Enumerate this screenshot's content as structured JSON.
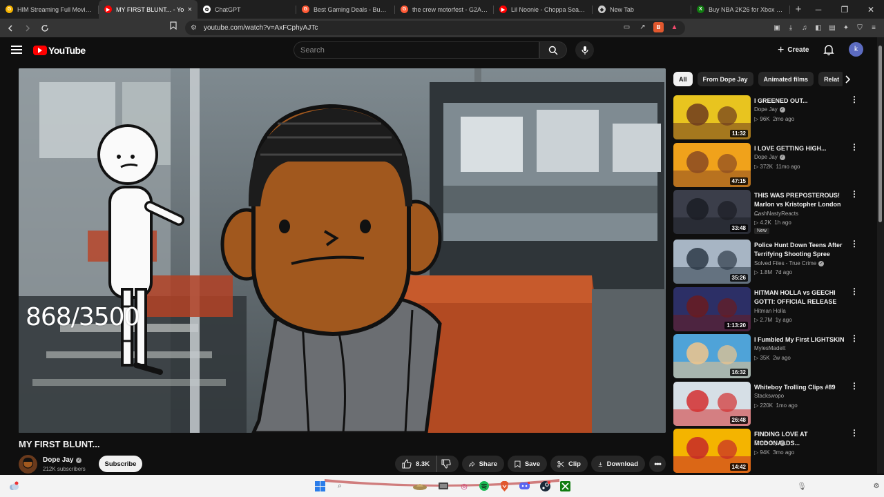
{
  "browser": {
    "tabs": [
      {
        "label": "HIM Streaming Full Movies On",
        "color": "#f6b400",
        "active": false,
        "glyph": "G"
      },
      {
        "label": "MY FIRST BLUNT... - Yo",
        "color": "#ff0000",
        "active": true,
        "glyph": "▶"
      },
      {
        "label": "ChatGPT",
        "color": "#ffffff",
        "active": false,
        "glyph": "✿"
      },
      {
        "label": "Best Gaming Deals - Buy Cheap",
        "color": "#ff5a36",
        "active": false,
        "glyph": "G"
      },
      {
        "label": "the crew motorfest - G2A.COM",
        "color": "#ff5a36",
        "active": false,
        "glyph": "G"
      },
      {
        "label": "Lil Noonie - Choppa Season |",
        "color": "#ff0000",
        "active": false,
        "glyph": "▶"
      },
      {
        "label": "New Tab",
        "color": "#cccccc",
        "active": false,
        "glyph": "◆"
      },
      {
        "label": "Buy NBA 2K26 for Xbox One |",
        "color": "#107c10",
        "active": false,
        "glyph": "X"
      }
    ],
    "url": "youtube.com/watch?v=AxFCphyAJTc"
  },
  "masthead": {
    "logo_text": "YouTube",
    "search_placeholder": "Search",
    "create_label": "Create",
    "avatar_letter": "k"
  },
  "player": {
    "overlay_counter": "868/3500"
  },
  "video": {
    "title": "MY FIRST BLUNT...",
    "channel": "Dope Jay",
    "subscribers": "212K subscribers",
    "subscribe_label": "Subscribe",
    "likes": "8.3K",
    "share_label": "Share",
    "save_label": "Save",
    "clip_label": "Clip",
    "download_label": "Download"
  },
  "chips": [
    "All",
    "From Dope Jay",
    "Animated films",
    "Relat"
  ],
  "recommendations": [
    {
      "title": "I GREENED OUT...",
      "channel": "Dope Jay",
      "verified": true,
      "views": "96K",
      "age": "2mo ago",
      "duration": "11:32",
      "bg": "#e8c41f",
      "accent": "#6d3b1e",
      "new": false
    },
    {
      "title": "I LOVE GETTING HIGH...",
      "channel": "Dope Jay",
      "verified": true,
      "views": "372K",
      "age": "11mo ago",
      "duration": "47:15",
      "bg": "#f0a21b",
      "accent": "#8a4a22",
      "new": false
    },
    {
      "title": "THIS WAS PREPOSTEROUS! Marlon vs Kristopher London ...",
      "channel": "CashNastyReacts",
      "verified": false,
      "views": "4.2K",
      "age": "1h ago",
      "duration": "33:48",
      "bg": "#3b3e4a",
      "accent": "#1b1d24",
      "new": true,
      "new_label": "New"
    },
    {
      "title": "Police Hunt Down Teens After Terrifying Shooting Spree",
      "channel": "Solved Files - True Crime",
      "verified": true,
      "views": "1.8M",
      "age": "7d ago",
      "duration": "35:26",
      "bg": "#a7b5c4",
      "accent": "#2d3a48",
      "new": false
    },
    {
      "title": "HITMAN HOLLA vs GEECHI GOTTI: OFFICIAL RELEASE",
      "channel": "Hitman Holla",
      "verified": false,
      "views": "2.7M",
      "age": "1y ago",
      "duration": "1:13:20",
      "bg": "#2c2f66",
      "accent": "#6a1b20",
      "new": false
    },
    {
      "title": "I Fumbled My First LIGHTSKIN",
      "channel": "MylesMadeIt",
      "verified": false,
      "views": "35K",
      "age": "2w ago",
      "duration": "16:32",
      "bg": "#4fa3d8",
      "accent": "#f0c58c",
      "new": false
    },
    {
      "title": "Whiteboy Trolling Clips #89",
      "channel": "Stackswopo",
      "verified": false,
      "views": "220K",
      "age": "1mo ago",
      "duration": "26:48",
      "bg": "#d6dfe6",
      "accent": "#d32f2f",
      "new": false
    },
    {
      "title": "FINDING LOVE AT MCDONALDS...",
      "channel": "Dope Jay",
      "verified": true,
      "views": "94K",
      "age": "3mo ago",
      "duration": "14:42",
      "bg": "#f4b400",
      "accent": "#c62828",
      "new": false
    }
  ],
  "taskbar": {
    "icons": [
      "windows-start",
      "search",
      "widgets",
      "file-manager",
      "media",
      "spotify",
      "brave",
      "discord",
      "steam",
      "xbox"
    ]
  }
}
